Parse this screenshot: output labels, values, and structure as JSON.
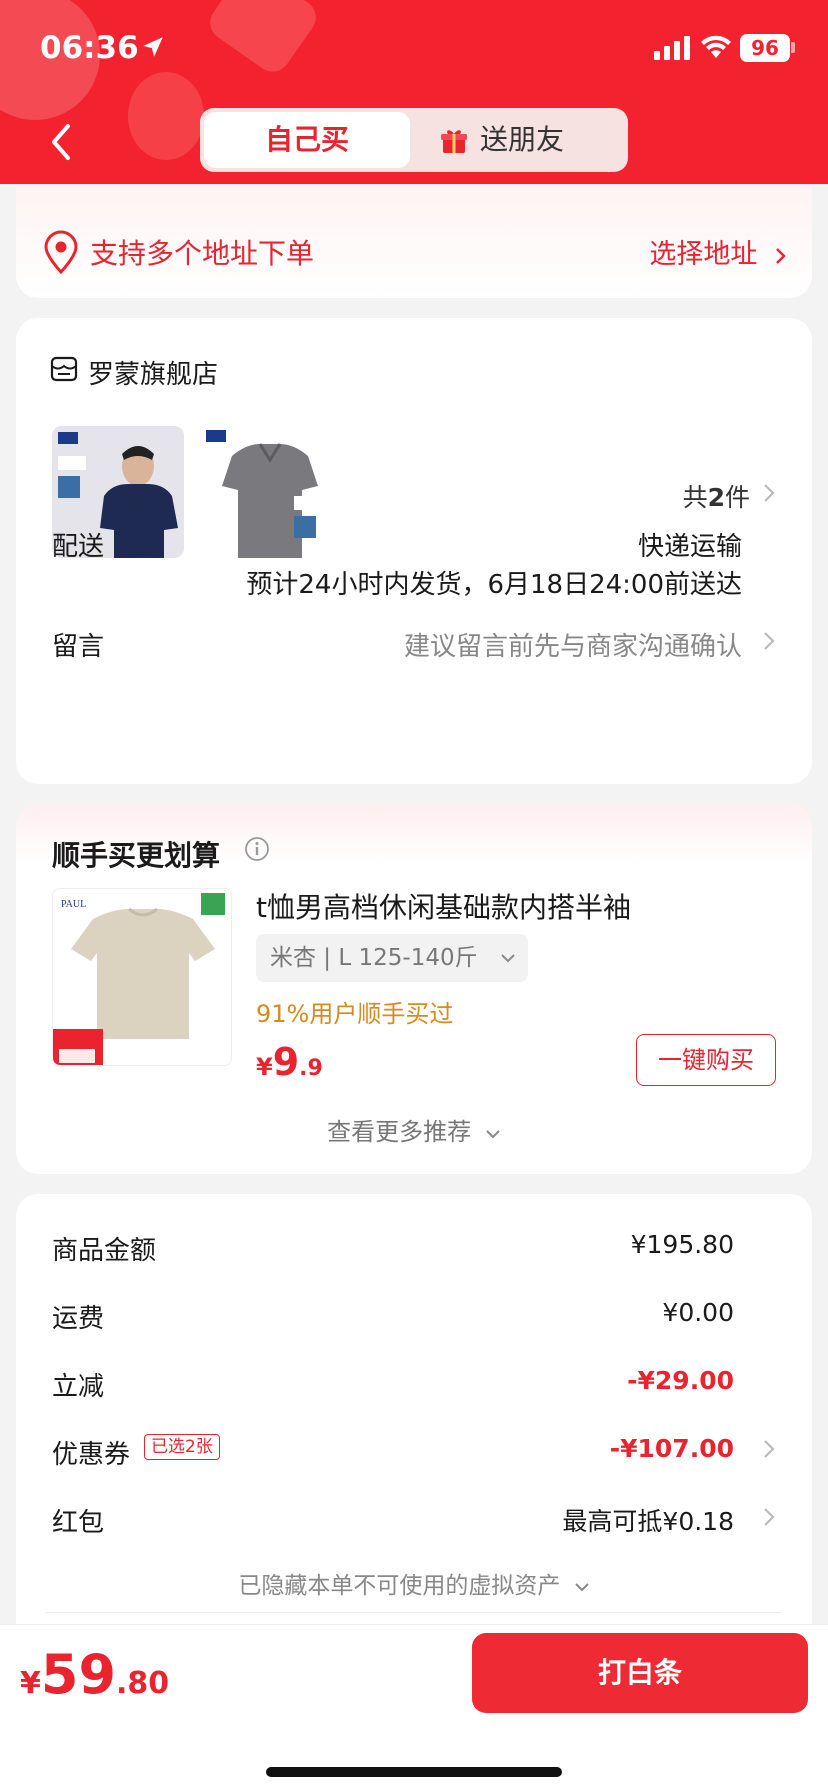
{
  "status_bar": {
    "time": "06:36",
    "battery": "96"
  },
  "header": {
    "tab_self": "自己买",
    "tab_gift": "送朋友"
  },
  "address": {
    "text": "支持多个地址下单",
    "choose": "选择地址"
  },
  "shop": {
    "name": "罗蒙旗舰店",
    "count_prefix": "共",
    "count_num": "2",
    "count_suffix": "件",
    "delivery_label": "配送",
    "delivery_method": "快递运输",
    "delivery_eta": "预计24小时内发货，6月18日24:00前送达",
    "message_label": "留言",
    "message_placeholder": "建议留言前先与商家沟通确认"
  },
  "recommend": {
    "title": "顺手买更划算",
    "name": "t恤男高档休闲基础款内搭半袖",
    "spec": "米杏 | L 125-140斤",
    "users": "91%用户顺手买过",
    "price_symbol": "¥",
    "price_int": "9",
    "price_dec": ".9",
    "buy": "一键购买",
    "more": "查看更多推荐"
  },
  "summary": {
    "goods_label": "商品金额",
    "goods_val": "¥195.80",
    "shipping_label": "运费",
    "shipping_val": "¥0.00",
    "discount_label": "立减",
    "discount_val": "-¥29.00",
    "coupon_label": "优惠券",
    "coupon_badge": "已选2张",
    "coupon_val": "-¥107.00",
    "redpacket_label": "红包",
    "redpacket_val": "最高可抵¥0.18",
    "hidden_note": "已隐藏本单不可使用的虚拟资产"
  },
  "footer": {
    "symbol": "¥",
    "total_int": "59",
    "total_dec": ".80",
    "pay": "打白条"
  },
  "colors": {
    "brand_red": "#f2232e",
    "accent_red": "#e9242e",
    "orange": "#d98a1f"
  }
}
